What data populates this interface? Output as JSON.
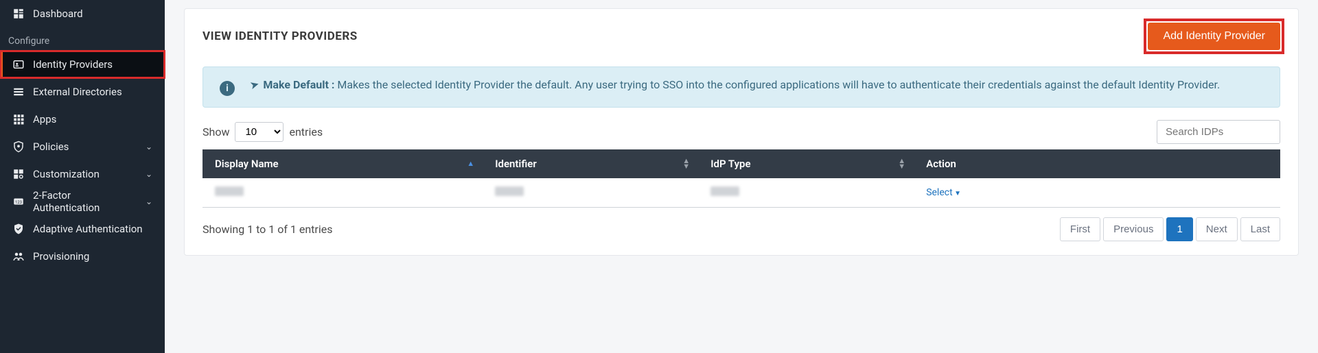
{
  "sidebar": {
    "dashboard": "Dashboard",
    "section_configure": "Configure",
    "identity_providers": "Identity Providers",
    "external_directories": "External Directories",
    "apps": "Apps",
    "policies": "Policies",
    "customization": "Customization",
    "two_factor": "2-Factor Authentication",
    "adaptive_auth": "Adaptive Authentication",
    "provisioning": "Provisioning"
  },
  "page": {
    "title": "VIEW IDENTITY PROVIDERS",
    "add_button": "Add Identity Provider"
  },
  "info": {
    "lead": "Make Default :",
    "body": " Makes the selected Identity Provider the default. Any user trying to SSO into the configured applications will have to authenticate their credentials against the default Identity Provider."
  },
  "table": {
    "show_prefix": "Show",
    "show_value": "10",
    "show_suffix": "entries",
    "search_placeholder": "Search IDPs",
    "columns": {
      "display_name": "Display Name",
      "identifier": "Identifier",
      "idp_type": "IdP Type",
      "action": "Action"
    },
    "row_action": "Select",
    "footer_info": "Showing 1 to 1 of 1 entries",
    "pager": {
      "first": "First",
      "previous": "Previous",
      "page": "1",
      "next": "Next",
      "last": "Last"
    }
  }
}
